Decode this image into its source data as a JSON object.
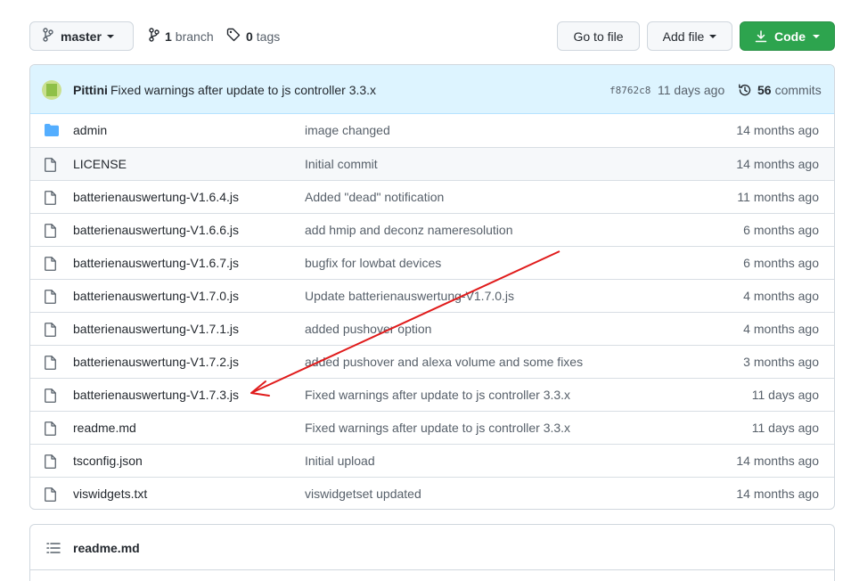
{
  "toolbar": {
    "branch_label": "master",
    "branches_count": "1",
    "branches_label": "branch",
    "tags_count": "0",
    "tags_label": "tags",
    "goto_file_label": "Go to file",
    "add_file_label": "Add file",
    "code_label": "Code"
  },
  "commit": {
    "author": "Pittini",
    "message": "Fixed warnings after update to js controller 3.3.x",
    "sha": "f8762c8",
    "age": "11 days ago",
    "count": "56",
    "count_label": "commits"
  },
  "files": [
    {
      "name": "admin",
      "type": "folder",
      "message": "image changed",
      "age": "14 months ago"
    },
    {
      "name": "LICENSE",
      "type": "file",
      "message": "Initial commit",
      "age": "14 months ago"
    },
    {
      "name": "batterienauswertung-V1.6.4.js",
      "type": "file",
      "message": "Added \"dead\" notification",
      "age": "11 months ago"
    },
    {
      "name": "batterienauswertung-V1.6.6.js",
      "type": "file",
      "message": "add hmip and deconz nameresolution",
      "age": "6 months ago"
    },
    {
      "name": "batterienauswertung-V1.6.7.js",
      "type": "file",
      "message": "bugfix for lowbat devices",
      "age": "6 months ago"
    },
    {
      "name": "batterienauswertung-V1.7.0.js",
      "type": "file",
      "message": "Update batterienauswertung-V1.7.0.js",
      "age": "4 months ago"
    },
    {
      "name": "batterienauswertung-V1.7.1.js",
      "type": "file",
      "message": "added pushover option",
      "age": "4 months ago"
    },
    {
      "name": "batterienauswertung-V1.7.2.js",
      "type": "file",
      "message": "added pushover and alexa volume and some fixes",
      "age": "3 months ago"
    },
    {
      "name": "batterienauswertung-V1.7.3.js",
      "type": "file",
      "message": "Fixed warnings after update to js controller 3.3.x",
      "age": "11 days ago"
    },
    {
      "name": "readme.md",
      "type": "file",
      "message": "Fixed warnings after update to js controller 3.3.x",
      "age": "11 days ago"
    },
    {
      "name": "tsconfig.json",
      "type": "file",
      "message": "Initial upload",
      "age": "14 months ago"
    },
    {
      "name": "viswidgets.txt",
      "type": "file",
      "message": "viswidgetset updated",
      "age": "14 months ago"
    }
  ],
  "readme": {
    "title": "readme.md"
  },
  "colors": {
    "code_button": "#2da44e",
    "commit_bar": "#ddf4ff",
    "folder_icon": "#54aeff",
    "annotation_arrow": "#e01b1b"
  }
}
